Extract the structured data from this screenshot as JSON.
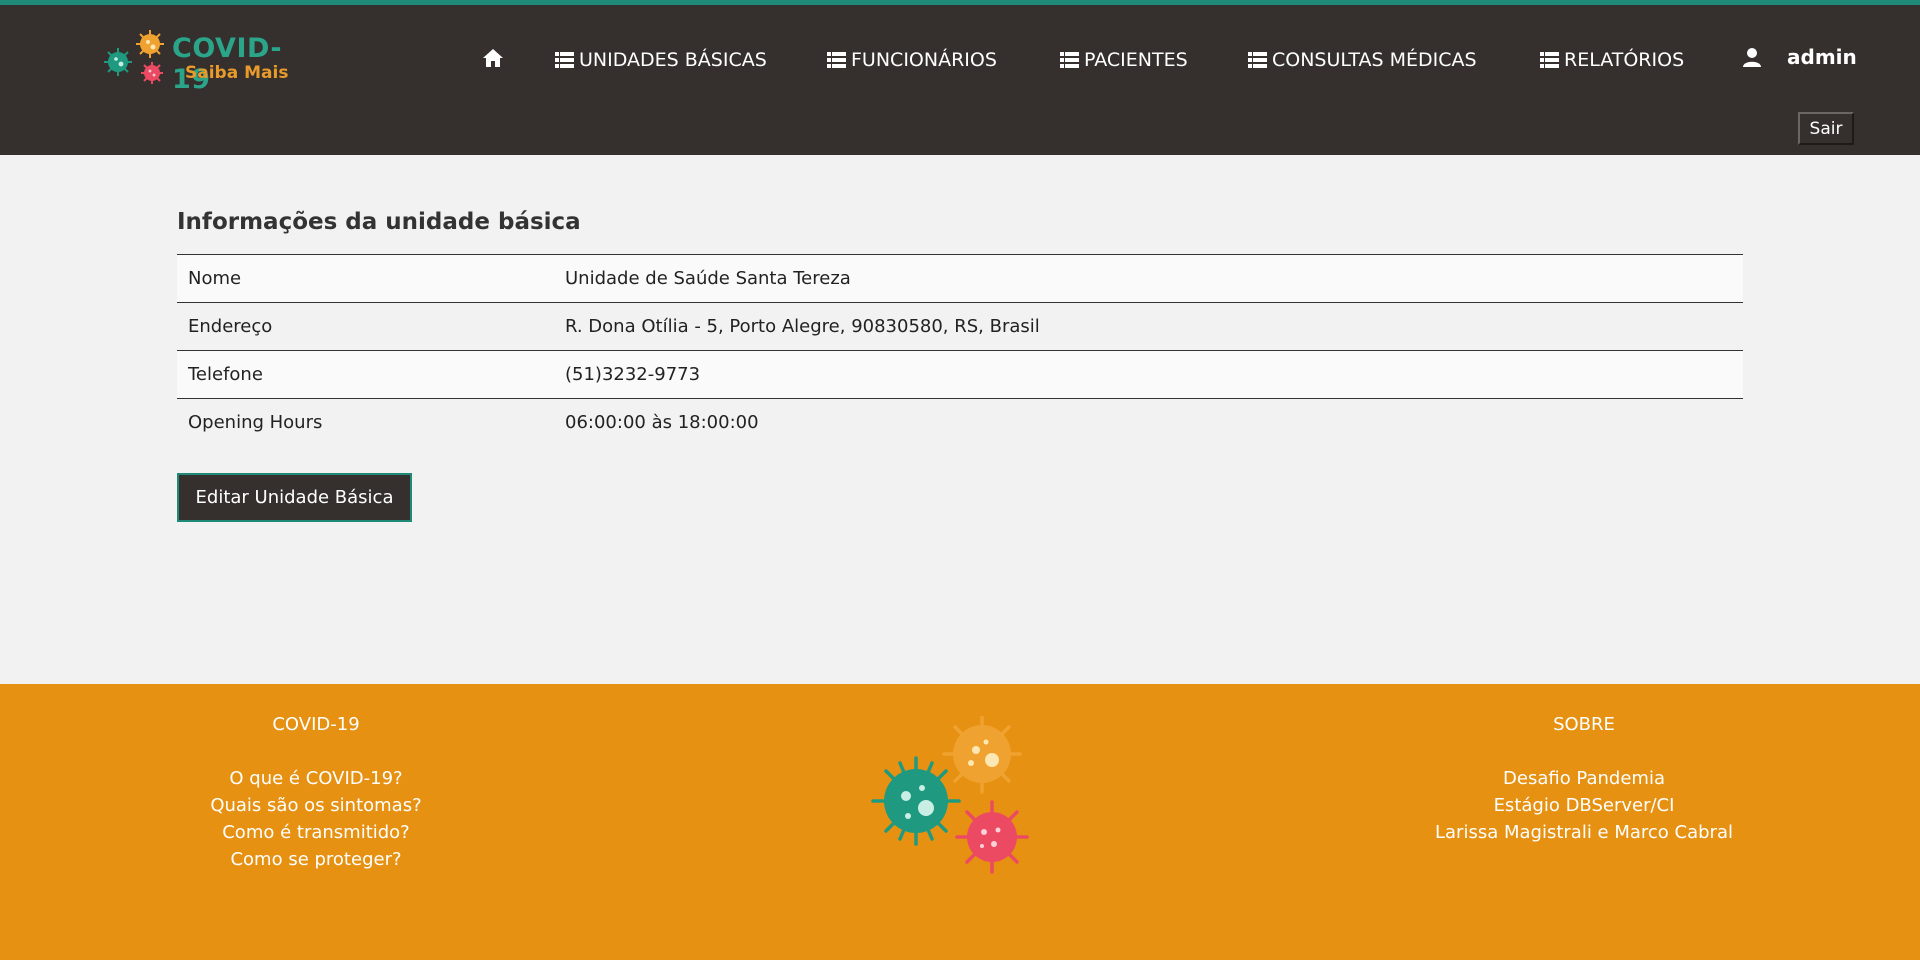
{
  "brand": {
    "title": "COVID-19",
    "subtitle": "Saiba Mais"
  },
  "nav": {
    "items": [
      {
        "label": "UNIDADES BÁSICAS"
      },
      {
        "label": "FUNCIONÁRIOS"
      },
      {
        "label": "PACIENTES"
      },
      {
        "label": "CONSULTAS MÉDICAS"
      },
      {
        "label": "RELATÓRIOS"
      }
    ],
    "user": "admin",
    "logout_label": "Sair"
  },
  "main": {
    "title": "Informações da unidade básica",
    "rows": [
      {
        "label": "Nome",
        "value": "Unidade de Saúde Santa Tereza"
      },
      {
        "label": "Endereço",
        "value": "R. Dona Otília - 5, Porto Alegre, 90830580, RS, Brasil"
      },
      {
        "label": "Telefone",
        "value": "(51)3232-9773"
      },
      {
        "label": "Opening Hours",
        "value": "06:00:00 às 18:00:00"
      }
    ],
    "edit_label": "Editar Unidade Básica"
  },
  "footer": {
    "left": {
      "heading": "COVID-19",
      "links": [
        "O que é COVID-19?",
        "Quais são os sintomas?",
        "Como é transmitido?",
        "Como se proteger?"
      ]
    },
    "right": {
      "heading": "SOBRE",
      "links": [
        "Desafio Pandemia",
        "Estágio DBServer/CI",
        "Larissa Magistrali e Marco Cabral"
      ]
    }
  },
  "colors": {
    "header_bg": "#35302d",
    "accent_teal": "#1f8a78",
    "footer_orange": "#e69112",
    "virus_orange": "#f0a230",
    "virus_teal": "#1f9a80",
    "virus_pink": "#ec4a63"
  },
  "icons": [
    "home-icon",
    "list-icon",
    "user-icon",
    "virus-icon"
  ]
}
